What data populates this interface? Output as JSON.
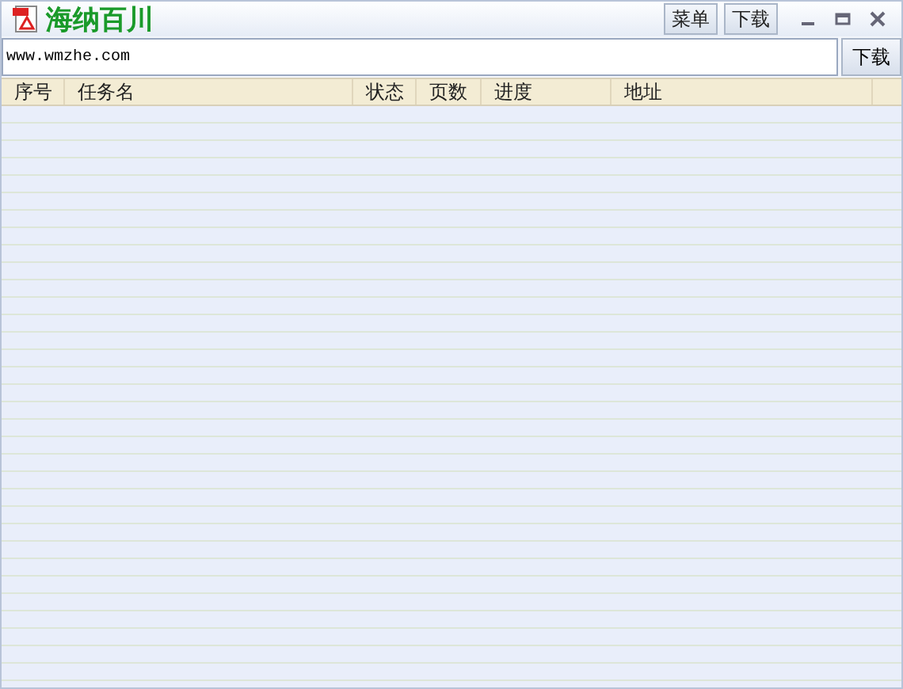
{
  "window": {
    "title": "海纳百川",
    "menu_button": "菜单",
    "download_tab": "下载"
  },
  "url_bar": {
    "value": "www.wmzhe.com",
    "button": "下载"
  },
  "table": {
    "columns": [
      "序号",
      "任务名",
      "状态",
      "页数",
      "进度",
      "地址"
    ]
  }
}
